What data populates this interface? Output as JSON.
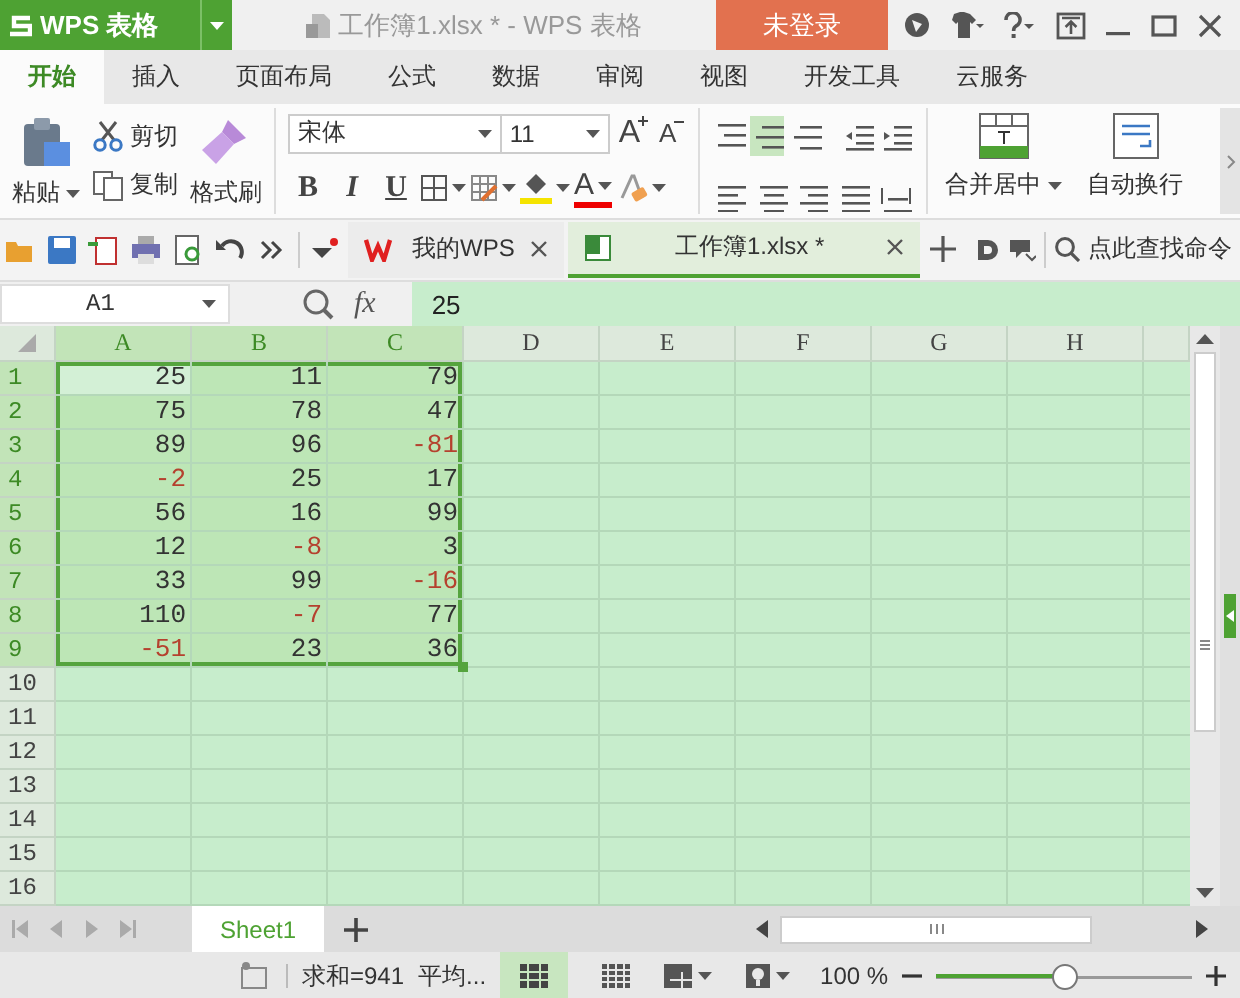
{
  "app_name": "WPS 表格",
  "window": {
    "title": "工作簿1.xlsx * - WPS 表格"
  },
  "login_button": "未登录",
  "ribbon_tabs": [
    {
      "label": "开始",
      "selected": true
    },
    {
      "label": "插入",
      "selected": false
    },
    {
      "label": "页面布局",
      "selected": false
    },
    {
      "label": "公式",
      "selected": false
    },
    {
      "label": "数据",
      "selected": false
    },
    {
      "label": "审阅",
      "selected": false
    },
    {
      "label": "视图",
      "selected": false
    },
    {
      "label": "开发工具",
      "selected": false
    },
    {
      "label": "云服务",
      "selected": false
    }
  ],
  "clipboard": {
    "paste": "粘贴",
    "cut": "剪切",
    "copy": "复制",
    "format_painter": "格式刷"
  },
  "font": {
    "name": "宋体",
    "size": "11",
    "grow": "A",
    "shrink": "A",
    "font_color": "A",
    "styles": [
      {
        "label": "B",
        "kind": "bold"
      },
      {
        "label": "I",
        "kind": "italic"
      },
      {
        "label": "U",
        "kind": "underline"
      }
    ]
  },
  "alignment": [
    {
      "kind": "top",
      "selected": false
    },
    {
      "kind": "middle",
      "selected": true
    },
    {
      "kind": "bottom",
      "selected": false
    },
    {
      "kind": "outdent",
      "selected": false
    },
    {
      "kind": "indent",
      "selected": false
    },
    {
      "kind": "left",
      "selected": false
    },
    {
      "kind": "center",
      "selected": false
    },
    {
      "kind": "right",
      "selected": false
    },
    {
      "kind": "justify",
      "selected": false
    },
    {
      "kind": "distributed",
      "selected": false
    }
  ],
  "merge": {
    "merge_center": "合并居中",
    "wrap_text": "自动换行"
  },
  "doc_tabs": [
    {
      "label": "我的WPS",
      "selected": false
    },
    {
      "label": "工作簿1.xlsx *",
      "selected": true
    }
  ],
  "command_search": {
    "placeholder": "点此查找命令"
  },
  "formula_bar": {
    "name_box": "A1",
    "fx": "fx",
    "value": "25"
  },
  "columns": [
    {
      "label": "A",
      "selected": true
    },
    {
      "label": "B",
      "selected": true
    },
    {
      "label": "C",
      "selected": true
    },
    {
      "label": "D",
      "selected": false
    },
    {
      "label": "E",
      "selected": false
    },
    {
      "label": "F",
      "selected": false
    },
    {
      "label": "G",
      "selected": false
    },
    {
      "label": "H",
      "selected": false
    }
  ],
  "rows": [
    {
      "number": "1",
      "selected": true,
      "cells": [
        {
          "value": "25",
          "negative": false,
          "active": true
        },
        {
          "value": "11",
          "negative": false,
          "active": false
        },
        {
          "value": "79",
          "negative": false,
          "active": false
        }
      ]
    },
    {
      "number": "2",
      "selected": true,
      "cells": [
        {
          "value": "75",
          "negative": false,
          "active": false
        },
        {
          "value": "78",
          "negative": false,
          "active": false
        },
        {
          "value": "47",
          "negative": false,
          "active": false
        }
      ]
    },
    {
      "number": "3",
      "selected": true,
      "cells": [
        {
          "value": "89",
          "negative": false,
          "active": false
        },
        {
          "value": "96",
          "negative": false,
          "active": false
        },
        {
          "value": "-81",
          "negative": true,
          "active": false
        }
      ]
    },
    {
      "number": "4",
      "selected": true,
      "cells": [
        {
          "value": "-2",
          "negative": true,
          "active": false
        },
        {
          "value": "25",
          "negative": false,
          "active": false
        },
        {
          "value": "17",
          "negative": false,
          "active": false
        }
      ]
    },
    {
      "number": "5",
      "selected": true,
      "cells": [
        {
          "value": "56",
          "negative": false,
          "active": false
        },
        {
          "value": "16",
          "negative": false,
          "active": false
        },
        {
          "value": "99",
          "negative": false,
          "active": false
        }
      ]
    },
    {
      "number": "6",
      "selected": true,
      "cells": [
        {
          "value": "12",
          "negative": false,
          "active": false
        },
        {
          "value": "-8",
          "negative": true,
          "active": false
        },
        {
          "value": "3",
          "negative": false,
          "active": false
        }
      ]
    },
    {
      "number": "7",
      "selected": true,
      "cells": [
        {
          "value": "33",
          "negative": false,
          "active": false
        },
        {
          "value": "99",
          "negative": false,
          "active": false
        },
        {
          "value": "-16",
          "negative": true,
          "active": false
        }
      ]
    },
    {
      "number": "8",
      "selected": true,
      "cells": [
        {
          "value": "110",
          "negative": false,
          "active": false
        },
        {
          "value": "-7",
          "negative": true,
          "active": false
        },
        {
          "value": "77",
          "negative": false,
          "active": false
        }
      ]
    },
    {
      "number": "9",
      "selected": true,
      "cells": [
        {
          "value": "-51",
          "negative": true,
          "active": false
        },
        {
          "value": "23",
          "negative": false,
          "active": false
        },
        {
          "value": "36",
          "negative": false,
          "active": false
        }
      ]
    },
    {
      "number": "10",
      "selected": false
    },
    {
      "number": "11",
      "selected": false
    },
    {
      "number": "12",
      "selected": false
    },
    {
      "number": "13",
      "selected": false
    },
    {
      "number": "14",
      "selected": false
    },
    {
      "number": "15",
      "selected": false
    },
    {
      "number": "16",
      "selected": false
    }
  ],
  "sheets": [
    {
      "label": "Sheet1",
      "selected": true
    }
  ],
  "status_bar": {
    "sum": "求和=941",
    "average": "平均...",
    "zoom": "100 %",
    "zoom_slider": {
      "level": 0.5
    }
  }
}
